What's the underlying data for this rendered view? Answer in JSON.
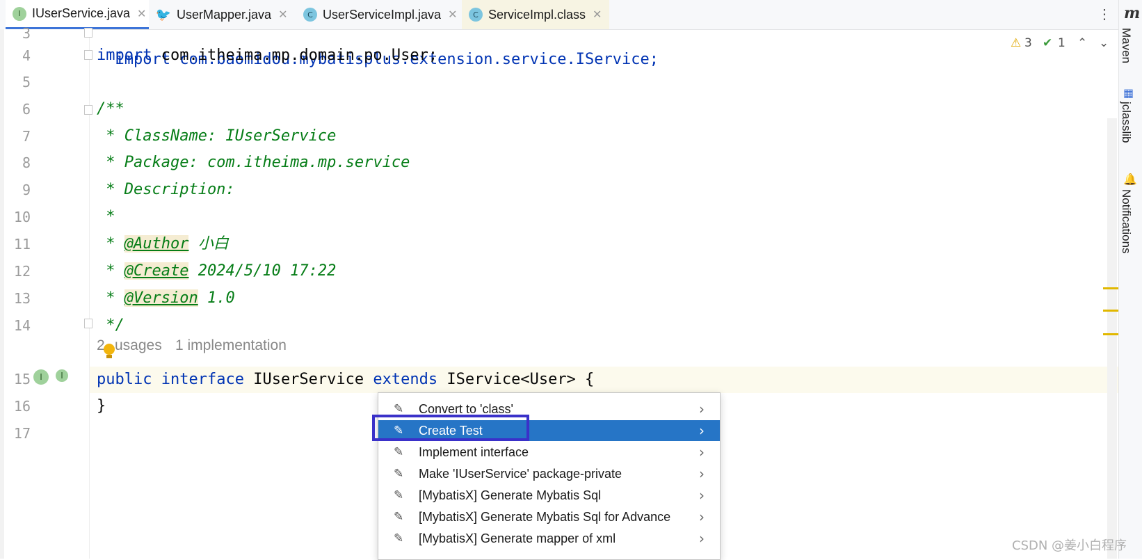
{
  "tabs": [
    {
      "label": "IUserService.java",
      "icon": "I",
      "icon_name": "interface-icon",
      "active": true
    },
    {
      "label": "UserMapper.java",
      "icon": "🐦",
      "icon_name": "mybatis-bird-icon",
      "active": false
    },
    {
      "label": "UserServiceImpl.java",
      "icon": "C",
      "icon_name": "class-icon",
      "active": false
    },
    {
      "label": "ServiceImpl.class",
      "icon": "C",
      "icon_name": "class-icon",
      "active": false
    }
  ],
  "tab_close_glyph": "✕",
  "more_glyph": "⋮",
  "line_numbers": [
    "3",
    "4",
    "5",
    "6",
    "7",
    "8",
    "9",
    "10",
    "11",
    "12",
    "13",
    "14",
    "15",
    "16",
    "17"
  ],
  "code": {
    "line3": "import com.baomidou.mybatisplus.extension.service.IService;",
    "line4_kw": "import",
    "line4_rest": " com.itheima.mp.domain.po.User;",
    "line6": "/**",
    "line7": " * ClassName: IUserService",
    "line8": " * Package: com.itheima.mp.service",
    "line9": " * Description:",
    "line10": " *",
    "line11_pre": " * ",
    "line11_tag": "@Author",
    "line11_val": " 小白",
    "line12_pre": " * ",
    "line12_tag": "@Create",
    "line12_val": " 2024/5/10 17:22",
    "line13_pre": " * ",
    "line13_tag": "@Version",
    "line13_val": " 1.0",
    "line14": " */",
    "usages_count": "2",
    "usages_label": "usages",
    "implementation_hint": "1 implementation",
    "line15_kw1": "public",
    "line15_kw2": "interface",
    "line15_name": "IUserService",
    "line15_kw3": "extends",
    "line15_rest": "IService<User> {",
    "line16": "}"
  },
  "inspections": {
    "warnings": "3",
    "warning_icon": "⚠",
    "ok": "1",
    "ok_icon": "✔",
    "up": "⌃",
    "down": "⌄"
  },
  "right_tools": {
    "maven_icon": "m",
    "maven": "Maven",
    "jclasslib": "jclasslib",
    "notifications": "Notifications"
  },
  "popup": {
    "items": [
      {
        "label": "Convert to 'class'",
        "selected": false
      },
      {
        "label": "Create Test",
        "selected": true
      },
      {
        "label": "Implement interface",
        "selected": false
      },
      {
        "label": "Make 'IUserService' package-private",
        "selected": false
      },
      {
        "label": "[MybatisX] Generate Mybatis Sql",
        "selected": false
      },
      {
        "label": "[MybatisX] Generate Mybatis Sql for Advance",
        "selected": false
      },
      {
        "label": "[MybatisX] Generate mapper of xml",
        "selected": false
      }
    ],
    "item_icon": "✎",
    "arrow": "›"
  },
  "watermark": "CSDN @姜小白程序",
  "colors": {
    "keyword": "#0033b3",
    "comment": "#067d17",
    "selection": "#2675c6",
    "annotation_box": "#3a31c9"
  }
}
